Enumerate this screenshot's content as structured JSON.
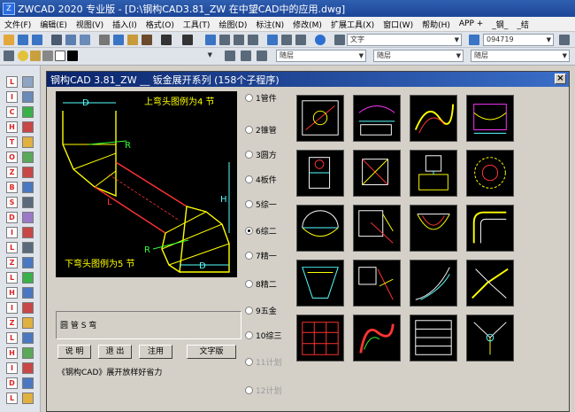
{
  "window": {
    "title": "ZWCAD 2020 专业版 - [D:\\钢构CAD3.81_ZW 在中望CAD中的应用.dwg]"
  },
  "menu": [
    "文件(F)",
    "编辑(E)",
    "视图(V)",
    "插入(I)",
    "格式(O)",
    "工具(T)",
    "绘图(D)",
    "标注(N)",
    "修改(M)",
    "扩展工具(X)",
    "窗口(W)",
    "帮助(H)",
    "APP +",
    "_钢_",
    "_结"
  ],
  "toolbar": {
    "text_style": "文字",
    "dim_style": "094719",
    "layer1": "随层",
    "layer2": "随层",
    "layer3": "随层"
  },
  "dialog": {
    "title": "钢构CAD 3.81_ZW __ 钣金展开系列  (158个子程序)",
    "close": "×",
    "preview": {
      "top_label": "上弯头图例为4 节",
      "bottom_label": "下弯头图例为5 节",
      "dim_d": "D",
      "dim_r": "R",
      "dim_l": "L",
      "dim_h": "H"
    },
    "description": "圆 管 S 弯",
    "buttons": {
      "explain": "说 明",
      "exit": "退 出",
      "register": "注用",
      "textbook": "文字版"
    },
    "footnote": "《钢构CAD》展开放样好省力",
    "categories": [
      {
        "label": "1管件",
        "enabled": true,
        "selected": false
      },
      {
        "label": "2锥管",
        "enabled": true,
        "selected": false
      },
      {
        "label": "3圆方",
        "enabled": true,
        "selected": false
      },
      {
        "label": "4板件",
        "enabled": true,
        "selected": false
      },
      {
        "label": "5综一",
        "enabled": true,
        "selected": false
      },
      {
        "label": "6综二",
        "enabled": true,
        "selected": true
      },
      {
        "label": "7精一",
        "enabled": true,
        "selected": false
      },
      {
        "label": "8精二",
        "enabled": true,
        "selected": false
      },
      {
        "label": "9五金",
        "enabled": true,
        "selected": false
      },
      {
        "label": "10综三",
        "enabled": true,
        "selected": false
      },
      {
        "label": "11计划",
        "enabled": false,
        "selected": false
      },
      {
        "label": "12计划",
        "enabled": false,
        "selected": false
      }
    ]
  }
}
